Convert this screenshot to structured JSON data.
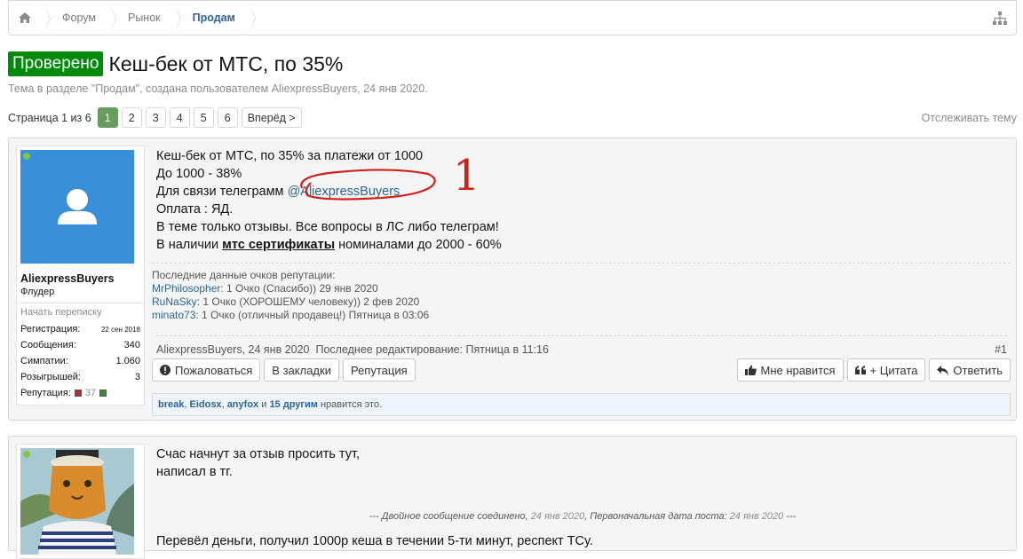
{
  "breadcrumb": {
    "items": [
      {
        "label": "Форум"
      },
      {
        "label": "Рынок"
      },
      {
        "label": "Продам"
      }
    ]
  },
  "thread": {
    "prefix": "Проверено",
    "title": "Кеш-бек от МТС, по 35%",
    "meta": "Тема в разделе \"Продам\", создана пользователем AliexpressBuyers, 24 янв 2020.",
    "watch": "Отслеживать тему"
  },
  "pagination": {
    "label": "Страница 1 из 6",
    "pages": [
      "1",
      "2",
      "3",
      "4",
      "5",
      "6"
    ],
    "current": "1",
    "next": "Вперёд >"
  },
  "post1": {
    "user": {
      "name": "AliexpressBuyers",
      "title": "Флудер",
      "start_conversation": "Начать переписку",
      "stats": [
        {
          "label": "Регистрация:",
          "value": "22 сен 2018"
        },
        {
          "label": "Сообщения:",
          "value": "340"
        },
        {
          "label": "Симпатии:",
          "value": "1.060"
        },
        {
          "label": "Розыгрышей:",
          "value": "3"
        },
        {
          "label": "Репутация:",
          "value": "37"
        }
      ]
    },
    "lines": {
      "l1": "Кеш-бек от МТС, по 35% за платежи от 1000",
      "l2": "До 1000 - 38%",
      "l3_prefix": "Для связи телеграмм",
      "l3_link": "@AliexpressBuyers",
      "l4": "Оплата : ЯД.",
      "l5": "В теме только отзывы. Все вопросы в ЛС либо телеграм!",
      "l6_prefix": "В наличии",
      "l6_bold": "мтс сертификаты",
      "l6_suffix": "номиналами до 2000 - 60%"
    },
    "annotation_mark": "1",
    "rep": {
      "heading": "Последние данные очков репутации:",
      "entries": [
        {
          "who": "MrPhilosopher",
          "text": ": 1 Очко (Спасибо))",
          "date": "29 янв 2020"
        },
        {
          "who": "RuNaSky",
          "text": ": 1 Очко (ХОРОШЕМУ человеку))",
          "date": "2 фев 2020"
        },
        {
          "who": "minato73",
          "text": ": 1 Очко (отличный продавец!)",
          "date": "Пятница в 03:06"
        }
      ]
    },
    "footer": {
      "author": "AliexpressBuyers",
      "date": "24 янв 2020",
      "edited": "Последнее редактирование: Пятница в 11:16",
      "number": "#1"
    },
    "buttons": {
      "report": "Пожаловаться",
      "bookmark": "В закладки",
      "reputation": "Репутация",
      "like": "Мне нравится",
      "quote": "+ Цитата",
      "reply": "Ответить"
    },
    "likes": {
      "u1": "break",
      "u2": "Eidosx",
      "u3": "anyfox",
      "and": "и",
      "others": "15 другим",
      "suffix": "нравится это."
    }
  },
  "post2": {
    "l1": "Счас начнут за отзыв просить тут,",
    "l2": "написал в тг.",
    "merged_a": "--- Двойное сообщение соединено,",
    "merged_date1": "24 янв 2020",
    "merged_b": ", Первоначальная дата поста:",
    "merged_date2": "24 янв 2020",
    "merged_c": "---",
    "l3": "Перевёл деньги, получил 1000р кеша в течении 5-ти минут, респект ТСу."
  },
  "colors": {
    "prefix_bg": "#008a0b",
    "link": "#2b6591",
    "page_active": "#6a9b5e",
    "annotation": "#d0201a"
  }
}
